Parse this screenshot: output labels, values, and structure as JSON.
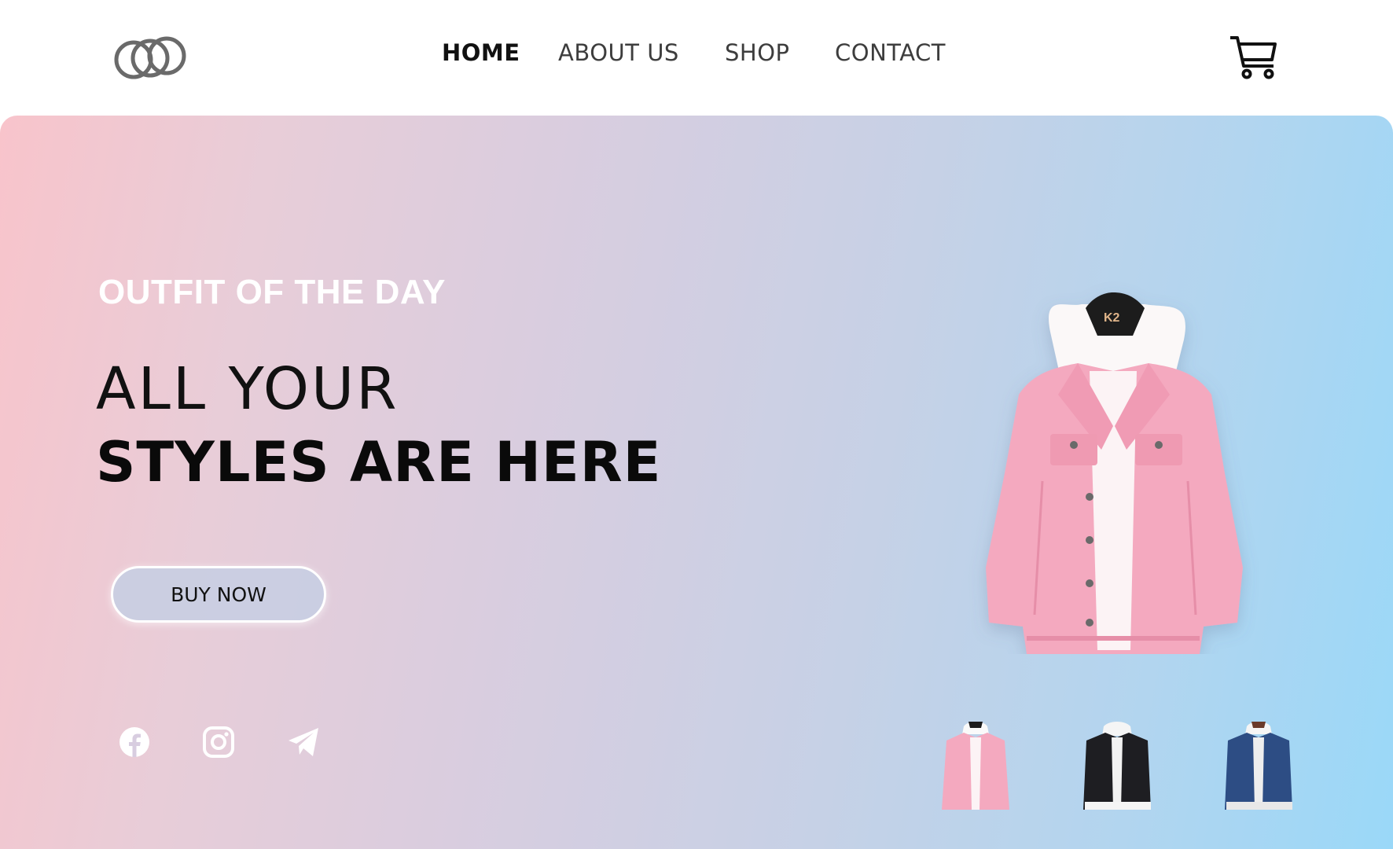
{
  "brand": {
    "logo_icon": "interlocking-circles-logo-icon"
  },
  "nav": {
    "items": [
      {
        "label": "HOME",
        "active": true
      },
      {
        "label": "ABOUT US",
        "active": false
      },
      {
        "label": "SHOP",
        "active": false
      },
      {
        "label": "CONTACT",
        "active": false
      }
    ],
    "cart_icon": "shopping-cart-icon"
  },
  "hero": {
    "kicker": "OUTFIT OF THE DAY",
    "headline_line1": "ALL YOUR",
    "headline_line2": "STYLES ARE HERE",
    "cta_label": "BUY NOW",
    "featured_product": {
      "hanger_label": "K2",
      "color": "#f4a9bf"
    },
    "thumbnails": [
      {
        "name": "pink",
        "color": "#f4a9bf"
      },
      {
        "name": "black",
        "color": "#1e1e22"
      },
      {
        "name": "blue",
        "color": "#2d4d84"
      }
    ]
  },
  "social": [
    {
      "icon": "facebook-icon"
    },
    {
      "icon": "instagram-icon"
    },
    {
      "icon": "telegram-icon"
    }
  ],
  "colors": {
    "gradient_start": "#f8c4cb",
    "gradient_end": "#9ad8f8",
    "nav_active": "#111111",
    "nav_text": "#3d3d3d"
  }
}
